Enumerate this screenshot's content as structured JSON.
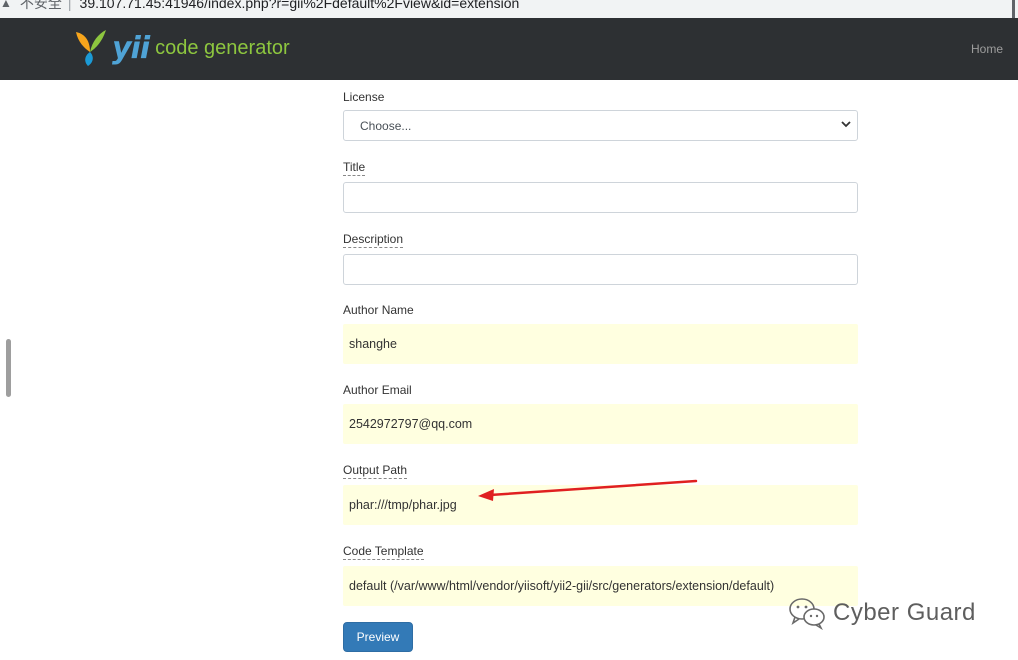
{
  "browser": {
    "security_label": "不安全",
    "url": "39.107.71.45:41946/index.php?r=gii%2Fdefault%2Fview&id=extension"
  },
  "navbar": {
    "logo_yii": "yii",
    "logo_code_generator": "code generator",
    "home_link": "Home"
  },
  "form": {
    "license": {
      "label": "License",
      "value": "Choose..."
    },
    "title": {
      "label": "Title",
      "value": ""
    },
    "description": {
      "label": "Description",
      "value": ""
    },
    "author_name": {
      "label": "Author Name",
      "value": "shanghe"
    },
    "author_email": {
      "label": "Author Email",
      "value": "2542972797@qq.com"
    },
    "output_path": {
      "label": "Output Path",
      "value": "phar:///tmp/phar.jpg"
    },
    "code_template": {
      "label": "Code Template",
      "value": "default (/var/www/html/vendor/yiisoft/yii2-gii/src/generators/extension/default)"
    },
    "preview_button": "Preview"
  },
  "watermark": {
    "text": "Cyber Guard",
    "icon": "wechat-icon"
  },
  "colors": {
    "navbar": "#2d3033",
    "sticky_field": "#ffffe0",
    "button": "#337ab7",
    "annotation_arrow": "#e02020"
  }
}
